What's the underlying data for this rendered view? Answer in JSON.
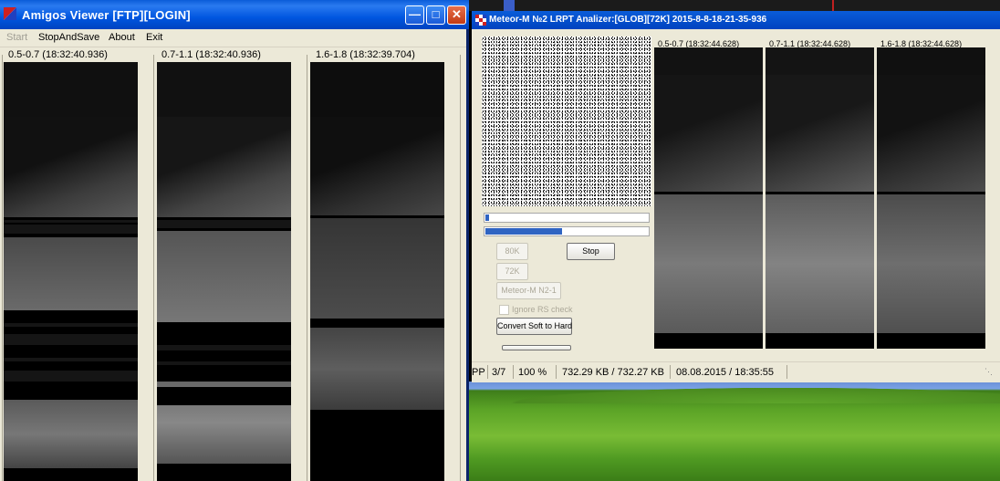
{
  "viewer": {
    "title": "Amigos Viewer [FTP][LOGIN]",
    "menu": {
      "start": "Start",
      "stop_and_save": "StopAndSave",
      "about": "About",
      "exit": "Exit"
    },
    "panels": [
      {
        "label": "0.5-0.7 (18:32:40.936)"
      },
      {
        "label": "0.7-1.1 (18:32:40.936)"
      },
      {
        "label": "1.6-1.8 (18:32:39.704)"
      }
    ]
  },
  "analyzer": {
    "title": "Meteor-M №2 LRPT Analizer:[GLOB][72K] 2015-8-8-18-21-35-936",
    "progress": [
      0.02,
      0.47
    ],
    "buttons": {
      "rate_80k": "80K",
      "stop": "Stop",
      "rate_72k": "72K",
      "satellite": "Meteor-M N2-1",
      "convert": "Convert Soft to Hard"
    },
    "ignore_rs_label": "Ignore RS check",
    "panels": [
      {
        "label": "0.5-0.7 (18:32:44.628)"
      },
      {
        "label": "0.7-1.1 (18:32:44.628)"
      },
      {
        "label": "1.6-1.8 (18:32:44.628)"
      }
    ],
    "status": {
      "mode": "PP",
      "frames": "3/7",
      "percent": "100 %",
      "size": "732.29 KB / 732.27 KB",
      "datetime": "08.08.2015 / 18:35:55"
    }
  }
}
